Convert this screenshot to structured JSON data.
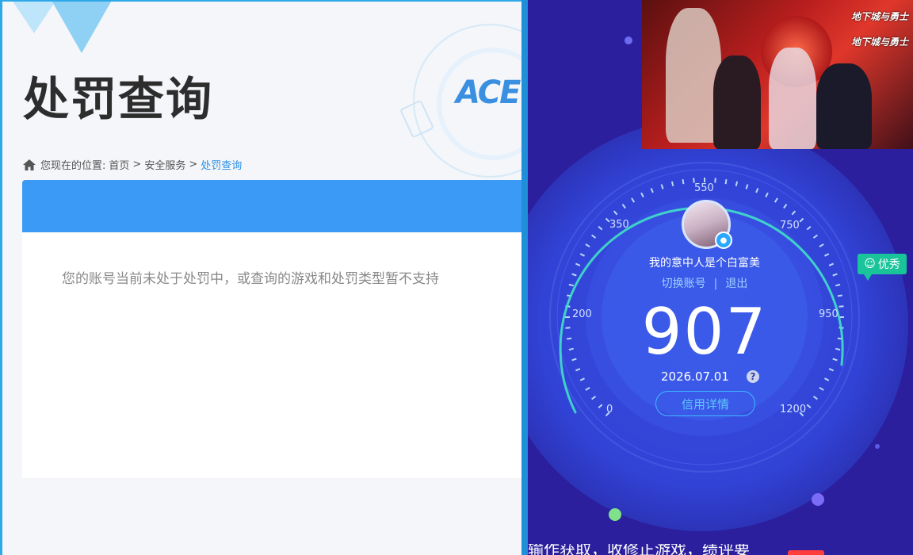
{
  "left_panel": {
    "page_title": "处罚查询",
    "breadcrumb": {
      "prefix": "您现在的位置:",
      "home": "首页",
      "separator": ">",
      "section": "安全服务",
      "current": "处罚查询"
    },
    "message": "您的账号当前未处于处罚中，或查询的游戏和处罚类型暂不支持",
    "deco_logo": "ACE",
    "colors": {
      "accent_blue": "#3b9af5",
      "link_blue": "#2a8ee6"
    }
  },
  "right_panel": {
    "banner": {
      "logo_top": "地下城与勇士",
      "logo_bottom": "地下城与勇士"
    },
    "profile": {
      "nickname": "我的意中人是个白富美",
      "switch_account": "切换账号",
      "divider": "|",
      "logout": "退出"
    },
    "gauge": {
      "ticks": [
        "0",
        "200",
        "350",
        "550",
        "750",
        "950",
        "1200"
      ],
      "min": 0,
      "max": 1200
    },
    "score": "907",
    "date": "2026.07.01",
    "help_icon_label": "?",
    "detail_button": "信用详情",
    "grade_badge": "优秀",
    "bottom_text": "输作获取，收修正游戏，绩评要",
    "colors": {
      "background": "#2b1f9e",
      "grade_green": "#19c49a",
      "button_blue": "#3fb9ff"
    }
  }
}
